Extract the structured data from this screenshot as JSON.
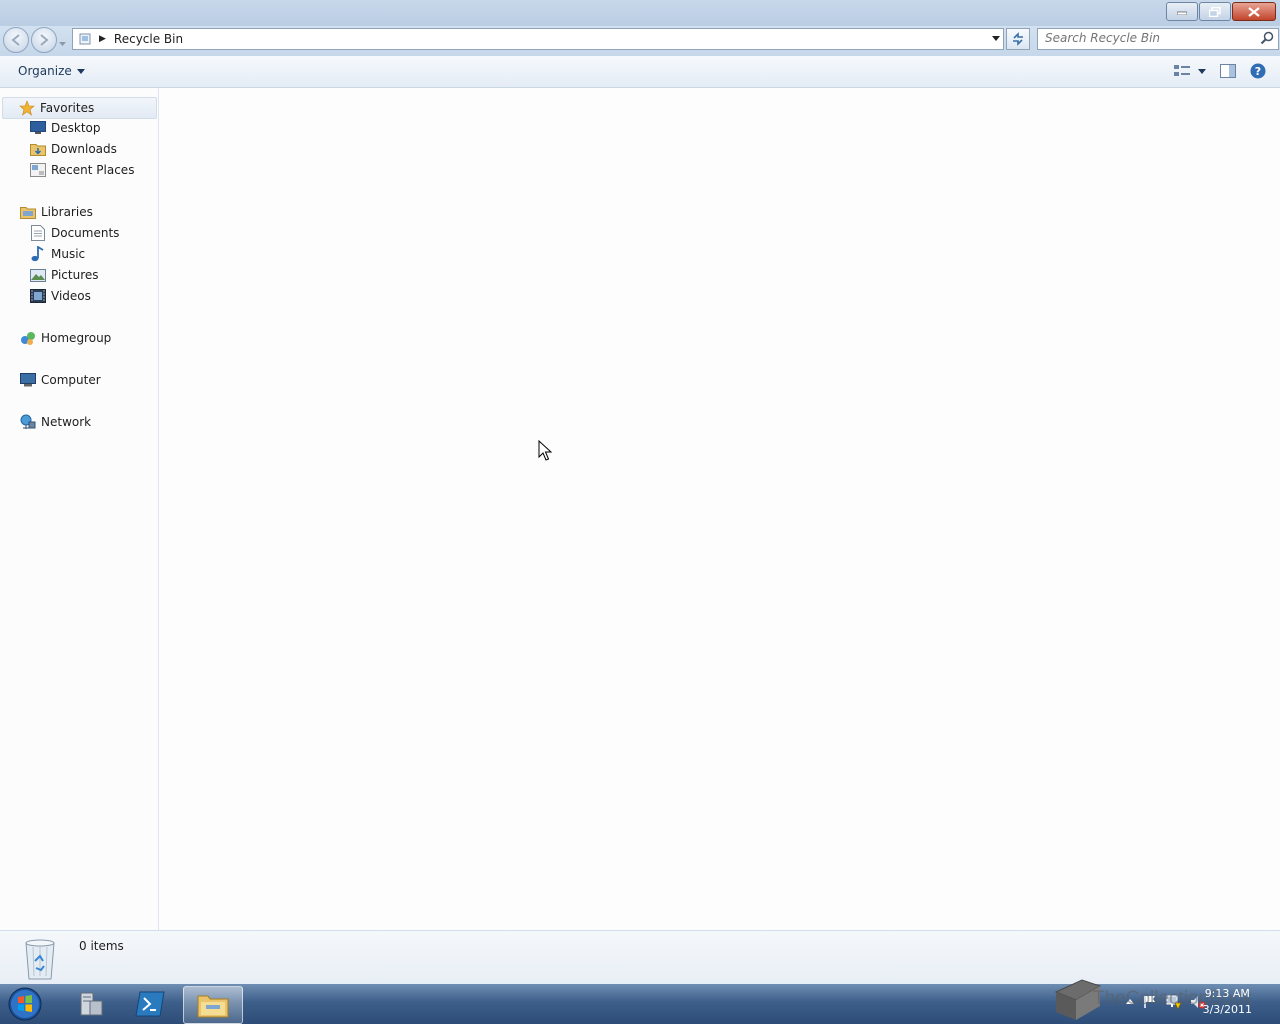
{
  "window": {
    "minimize_icon": "minimize-icon",
    "maximize_icon": "restore-icon",
    "close_icon": "close-icon"
  },
  "navbar": {
    "breadcrumb": "Recycle Bin",
    "search_placeholder": "Search Recycle Bin"
  },
  "command_bar": {
    "organize_label": "Organize"
  },
  "nav_pane": {
    "favorites": {
      "label": "Favorites",
      "items": [
        "Desktop",
        "Downloads",
        "Recent Places"
      ]
    },
    "libraries": {
      "label": "Libraries",
      "items": [
        "Documents",
        "Music",
        "Pictures",
        "Videos"
      ]
    },
    "homegroup": "Homegroup",
    "computer": "Computer",
    "network": "Network"
  },
  "details": {
    "item_count": "0 items"
  },
  "taskbar": {
    "watermark": "TheCollectionBook",
    "time": "9:13 AM",
    "date": "3/3/2011"
  },
  "colors": {
    "titlebar": "#c8d8ea",
    "taskbar": "#3d5f8a",
    "accent": "#1e395b"
  }
}
